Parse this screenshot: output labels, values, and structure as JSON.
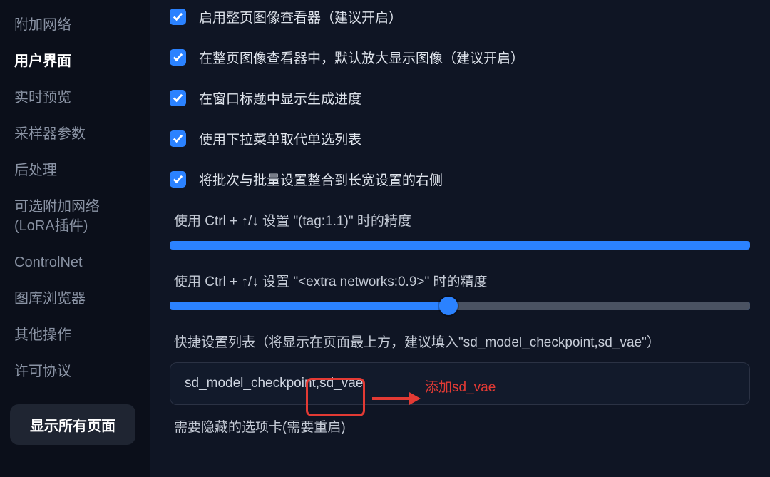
{
  "sidebar": {
    "items": [
      {
        "label": "附加网络"
      },
      {
        "label": "用户界面",
        "active": true
      },
      {
        "label": "实时预览"
      },
      {
        "label": "采样器参数"
      },
      {
        "label": "后处理"
      },
      {
        "label": "可选附加网络(LoRA插件)"
      },
      {
        "label": "ControlNet"
      },
      {
        "label": "图库浏览器"
      },
      {
        "label": "其他操作"
      },
      {
        "label": "许可协议"
      }
    ],
    "show_all_pages_label": "显示所有页面"
  },
  "main": {
    "checkboxes": [
      {
        "label": "启用整页图像查看器（建议开启）",
        "checked": true
      },
      {
        "label": "在整页图像查看器中，默认放大显示图像（建议开启）",
        "checked": true
      },
      {
        "label": "在窗口标题中显示生成进度",
        "checked": true
      },
      {
        "label": "使用下拉菜单取代单选列表",
        "checked": true
      },
      {
        "label": "将批次与批量设置整合到长宽设置的右侧",
        "checked": true
      }
    ],
    "slider1_label": "使用 Ctrl + ↑/↓ 设置 \"(tag:1.1)\" 时的精度",
    "slider1_percent": 100,
    "slider2_label": "使用 Ctrl + ↑/↓ 设置 \"<extra networks:0.9>\" 时的精度",
    "slider2_percent": 48,
    "quick_settings_label": "快捷设置列表（将显示在页面最上方，建议填入\"sd_model_checkpoint,sd_vae\"）",
    "quick_settings_value": "sd_model_checkpoint,sd_vae",
    "hidden_tabs_label": "需要隐藏的选项卡(需要重启)"
  },
  "annotation": {
    "text": "添加sd_vae"
  }
}
